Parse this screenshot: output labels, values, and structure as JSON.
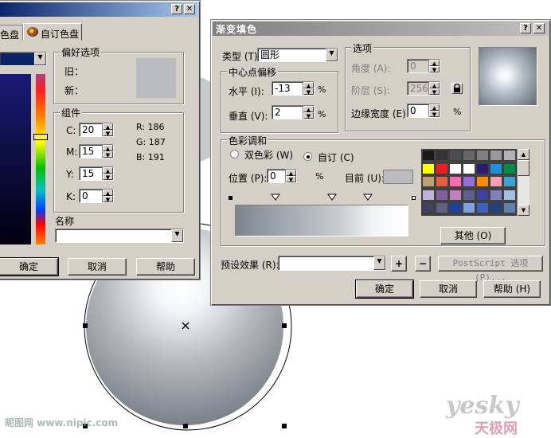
{
  "palette_dialog": {
    "tab_left_label": "色盘",
    "tab_right_label": "自订色盘",
    "prefs_group": "偏好选项",
    "old_label": "旧：",
    "new_label": "新：",
    "components_group": "组件",
    "c_label": "C:",
    "c_value": "20",
    "m_label": "M:",
    "m_value": "15",
    "y_label": "Y:",
    "y_value": "15",
    "k_label": "K:",
    "k_value": "0",
    "r_text": "R:  186",
    "g_text": "G:  187",
    "b_text": "B:  191",
    "name_label": "名称",
    "name_value": "",
    "ok": "确定",
    "cancel": "取消",
    "help": "帮助",
    "preview_color": "#babbbf"
  },
  "gradient_dialog": {
    "title": "渐变填色",
    "type_label": "类型 (T)",
    "type_value": "圆形",
    "center_group": "中心点偏移",
    "horizontal_label": "水平 (I):",
    "horizontal_value": "-13",
    "vertical_label": "垂直 (V):",
    "vertical_value": "2",
    "percent": "%",
    "options_group": "选项",
    "angle_label": "角度 (A):",
    "angle_value": "0",
    "steps_label": "阶层 (S):",
    "steps_value": "256",
    "edge_label": "边缘宽度 (E):",
    "edge_value": "0",
    "blend_group": "色彩调和",
    "two_color_label": "双色彩 (W)",
    "custom_label": "自订 (C)",
    "position_label": "位置 (P):",
    "position_value": "0",
    "current_label": "目前 (U):",
    "other_button": "其他 (O)",
    "preset_label": "预设效果 (R):",
    "preset_value": "",
    "plus": "+",
    "minus": "−",
    "postscript": "PostScript 选项 (P)...",
    "ok": "确定",
    "cancel": "取消",
    "help": "帮助 (H)",
    "palette_colors": [
      "#1a1a1a",
      "#333333",
      "#4d4d4d",
      "#666666",
      "#808080",
      "#999999",
      "#b3b3b3",
      "#ffff00",
      "#ee1c25",
      "#ffffff",
      "#ffffff",
      "#2e1a6e",
      "#1e90e0",
      "#008b45",
      "#c0a070",
      "#e06040",
      "#ff69b4",
      "#9370db",
      "#ff8c00",
      "#f5a0b0",
      "#40a0d0",
      "#c0b0e0",
      "#8060a0",
      "#c080c0",
      "#606090",
      "#4040a0",
      "#8080c0",
      "#a0c0e0",
      "#404060",
      "#606080",
      "#2040a0",
      "#80a0e0",
      "#4060c0",
      "#204080",
      "#6080b0"
    ]
  },
  "watermarks": {
    "left": "昵图网 www.nipic.com",
    "right_latin": "yesky",
    "right_cjk": "天极网"
  }
}
